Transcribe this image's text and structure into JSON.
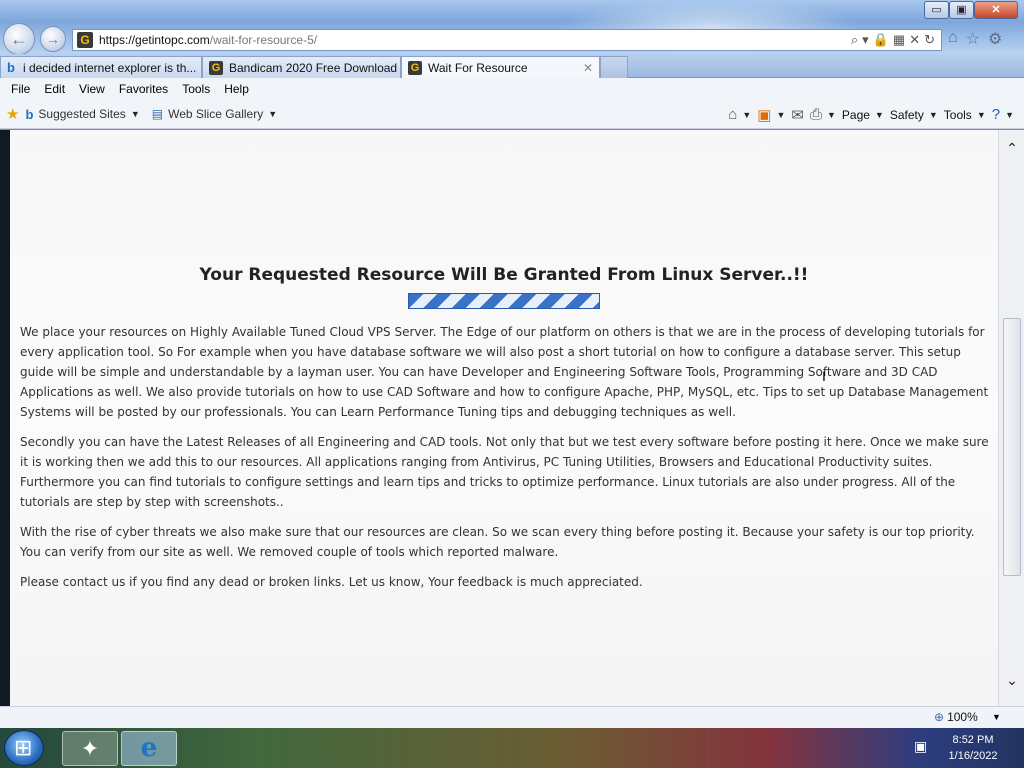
{
  "window": {
    "minimize_label": "▭",
    "maximize_label": "▣",
    "close_label": "✕"
  },
  "address_bar": {
    "url_host": "https://getintopc.com",
    "url_path": "/wait-for-resource-5/"
  },
  "tabs": [
    {
      "label": "i decided internet explorer is th...",
      "favicon": "bing-icon"
    },
    {
      "label": "Bandicam 2020 Free Download",
      "favicon": "getintopc-icon"
    },
    {
      "label": "Wait For Resource",
      "favicon": "getintopc-icon",
      "active": true
    }
  ],
  "menu": [
    "File",
    "Edit",
    "View",
    "Favorites",
    "Tools",
    "Help"
  ],
  "favorites_bar": {
    "suggested_sites": "Suggested Sites",
    "web_slice_gallery": "Web Slice Gallery"
  },
  "command_bar": {
    "page": "Page",
    "safety": "Safety",
    "tools": "Tools"
  },
  "page": {
    "title": "Your Requested Resource Will Be Granted From Linux Server..!!",
    "paragraphs": [
      "We place your resources on Highly Available Tuned Cloud VPS Server. The Edge of our platform on others is that we are in the process of developing tutorials for every application tool. So For example when you have database software we will also post a short tutorial on how to configure a database server. This setup guide will be simple and understandable by a layman user. You can have Developer and Engineering Software Tools, Programming Software and 3D CAD Applications as well. We also provide tutorials on how to use CAD Software and how to configure Apache, PHP, MySQL, etc. Tips to set up Database Management Systems will be posted by our professionals. You can Learn Performance Tuning tips and debugging techniques as well.",
      "Secondly you can have the Latest Releases of all Engineering and CAD tools. Not only that but we test every software before posting it here. Once we make sure it is working then we add this to our resources. All applications ranging from Antivirus, PC Tuning Utilities, Browsers and Educational Productivity suites. Furthermore you can find tutorials to configure settings and learn tips and tricks to optimize performance. Linux tutorials are also under progress. All of the tutorials are step by step with screenshots..",
      "With the rise of cyber threats we also make sure that our resources are clean. So we scan every thing before posting it. Because your safety is our top priority. You can verify from our site as well. We removed couple of tools which reported malware.",
      "Please contact us if you find any dead or broken links. Let us know, Your feedback is much appreciated."
    ]
  },
  "status_bar": {
    "zoom": "100%"
  },
  "taskbar": {
    "time": "8:52 PM",
    "date": "1/16/2022"
  }
}
